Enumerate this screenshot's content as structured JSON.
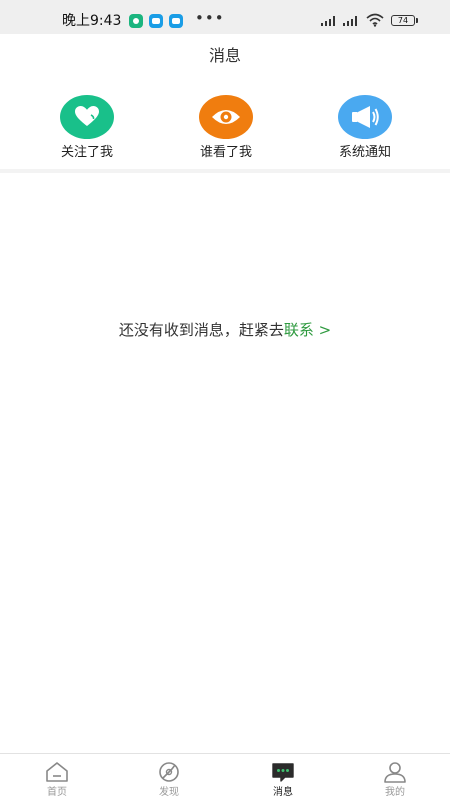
{
  "status_bar": {
    "time": "晚上9:43",
    "more": "•••",
    "battery": "74"
  },
  "header": {
    "title": "消息"
  },
  "categories": [
    {
      "label": "关注了我",
      "icon": "heart-icon",
      "color": "#19c08a"
    },
    {
      "label": "谁看了我",
      "icon": "eye-icon",
      "color": "#f07d0f"
    },
    {
      "label": "系统通知",
      "icon": "megaphone-icon",
      "color": "#4aa9f0"
    }
  ],
  "empty_state": {
    "text": "还没有收到消息，赶紧去",
    "link": "联系 >"
  },
  "tabs": [
    {
      "label": "首页",
      "icon": "home-icon",
      "active": false
    },
    {
      "label": "发现",
      "icon": "discover-icon",
      "active": false
    },
    {
      "label": "消息",
      "icon": "message-icon",
      "active": true
    },
    {
      "label": "我的",
      "icon": "profile-icon",
      "active": false
    }
  ],
  "colors": {
    "accent_green": "#2e9a3f",
    "tab_active": "#222222",
    "tab_inactive": "#999999"
  }
}
